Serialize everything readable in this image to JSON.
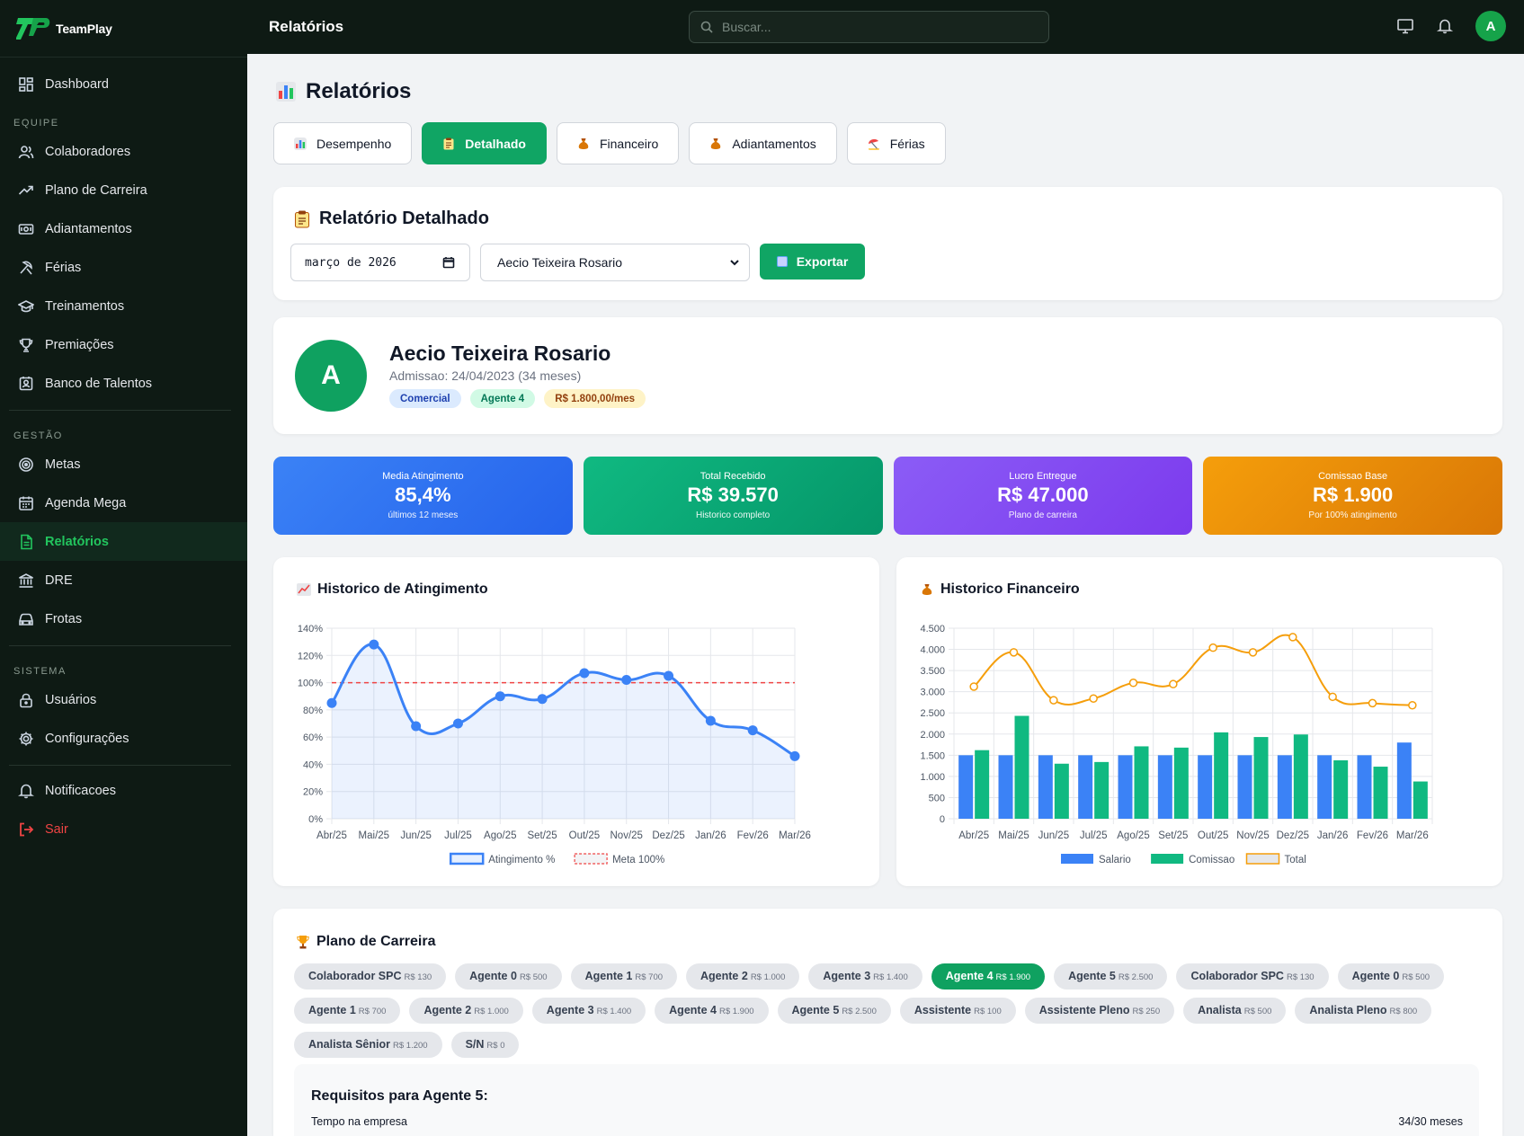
{
  "brand": {
    "name": "TeamPlay"
  },
  "sidebar": {
    "dashboard": "Dashboard",
    "sections": {
      "equipe": "EQUIPE",
      "gestao": "GESTÃO",
      "sistema": "SISTEMA"
    },
    "equipe": [
      "Colaboradores",
      "Plano de Carreira",
      "Adiantamentos",
      "Férias",
      "Treinamentos",
      "Premiações",
      "Banco de Talentos"
    ],
    "gestao": [
      "Metas",
      "Agenda Mega",
      "Relatórios",
      "DRE",
      "Frotas"
    ],
    "sistema": [
      "Usuários",
      "Configurações"
    ],
    "notificacoes": "Notificacoes",
    "sair": "Sair"
  },
  "topbar": {
    "title": "Relatórios",
    "search_placeholder": "Buscar...",
    "avatar": "A"
  },
  "page": {
    "title": "Relatórios",
    "tabs": [
      "Desempenho",
      "Detalhado",
      "Financeiro",
      "Adiantamentos",
      "Férias"
    ],
    "active_tab": "Detalhado"
  },
  "filters": {
    "title": "Relatório Detalhado",
    "month": "março de 2026",
    "employee": "Aecio Teixeira Rosario",
    "export_label": "Exportar"
  },
  "profile": {
    "initial": "A",
    "name": "Aecio Teixeira Rosario",
    "admission": "Admissao: 24/04/2023 (34 meses)",
    "badges": [
      "Comercial",
      "Agente 4",
      "R$ 1.800,00/mes"
    ]
  },
  "stats": [
    {
      "label": "Media Atingimento",
      "value": "85,4%",
      "note": "últimos 12 meses",
      "color": "#3b82f6"
    },
    {
      "label": "Total Recebido",
      "value": "R$ 39.570",
      "note": "Historico completo",
      "color": "#10b981"
    },
    {
      "label": "Lucro Entregue",
      "value": "R$ 47.000",
      "note": "Plano de carreira",
      "color": "#8b5cf6"
    },
    {
      "label": "Comissao Base",
      "value": "R$ 1.900",
      "note": "Por 100% atingimento",
      "color": "#f59e0b"
    }
  ],
  "chart_data": [
    {
      "type": "line",
      "title": "Historico de Atingimento",
      "categories": [
        "Abr/25",
        "Mai/25",
        "Jun/25",
        "Jul/25",
        "Ago/25",
        "Set/25",
        "Out/25",
        "Nov/25",
        "Dez/25",
        "Jan/26",
        "Fev/26",
        "Mar/26"
      ],
      "series": [
        {
          "name": "Atingimento %",
          "values": [
            85,
            128,
            68,
            70,
            90,
            88,
            107,
            102,
            105,
            72,
            65,
            46
          ],
          "color": "#3b82f6"
        },
        {
          "name": "Meta 100%",
          "values": [
            100,
            100,
            100,
            100,
            100,
            100,
            100,
            100,
            100,
            100,
            100,
            100
          ],
          "color": "#ef4444",
          "dashed": true
        }
      ],
      "yticks": [
        "0%",
        "20%",
        "40%",
        "60%",
        "80%",
        "100%",
        "120%",
        "140%"
      ],
      "ylim": [
        0,
        140
      ],
      "grid": true,
      "legend": "bottom"
    },
    {
      "type": "bar",
      "title": "Historico Financeiro",
      "categories": [
        "Abr/25",
        "Mai/25",
        "Jun/25",
        "Jul/25",
        "Ago/25",
        "Set/25",
        "Out/25",
        "Nov/25",
        "Dez/25",
        "Jan/26",
        "Fev/26",
        "Mar/26"
      ],
      "series": [
        {
          "name": "Salario",
          "values": [
            1500,
            1500,
            1500,
            1500,
            1500,
            1500,
            1500,
            1500,
            1500,
            1500,
            1500,
            1800
          ],
          "color": "#3b82f6"
        },
        {
          "name": "Comissao",
          "values": [
            1620,
            2430,
            1300,
            1340,
            1710,
            1680,
            2040,
            1930,
            1990,
            1380,
            1230,
            880
          ],
          "color": "#10b981"
        },
        {
          "name": "Total",
          "values": [
            3120,
            3930,
            2800,
            2840,
            3210,
            3180,
            4040,
            3930,
            4290,
            2880,
            2730,
            2680
          ],
          "color": "#f59e0b",
          "kind": "line"
        }
      ],
      "yticks": [
        "0",
        "500",
        "1.000",
        "1.500",
        "2.000",
        "2.500",
        "3.000",
        "3.500",
        "4.000",
        "4.500"
      ],
      "ylim": [
        0,
        4500
      ],
      "grid": true,
      "legend": "bottom"
    }
  ],
  "career": {
    "title": "Plano de Carreira",
    "levels": [
      {
        "name": "Colaborador SPC",
        "value": "R$ 130"
      },
      {
        "name": "Agente 0",
        "value": "R$ 500"
      },
      {
        "name": "Agente 1",
        "value": "R$ 700"
      },
      {
        "name": "Agente 2",
        "value": "R$ 1.000"
      },
      {
        "name": "Agente 3",
        "value": "R$ 1.400"
      },
      {
        "name": "Agente 4",
        "value": "R$ 1.900",
        "active": true
      },
      {
        "name": "Agente 5",
        "value": "R$ 2.500"
      },
      {
        "name": "Colaborador SPC",
        "value": "R$ 130"
      },
      {
        "name": "Agente 0",
        "value": "R$ 500"
      },
      {
        "name": "Agente 1",
        "value": "R$ 700"
      },
      {
        "name": "Agente 2",
        "value": "R$ 1.000"
      },
      {
        "name": "Agente 3",
        "value": "R$ 1.400"
      },
      {
        "name": "Agente 4",
        "value": "R$ 1.900"
      },
      {
        "name": "Agente 5",
        "value": "R$ 2.500"
      },
      {
        "name": "Assistente",
        "value": "R$ 100"
      },
      {
        "name": "Assistente Pleno",
        "value": "R$ 250"
      },
      {
        "name": "Analista",
        "value": "R$ 500"
      },
      {
        "name": "Analista Pleno",
        "value": "R$ 800"
      },
      {
        "name": "Analista Sênior",
        "value": "R$ 1.200"
      },
      {
        "name": "S/N",
        "value": "R$ 0"
      }
    ],
    "requirements_title": "Requisitos para Agente 5:",
    "requirement_label": "Tempo na empresa",
    "requirement_value": "34/30 meses"
  }
}
